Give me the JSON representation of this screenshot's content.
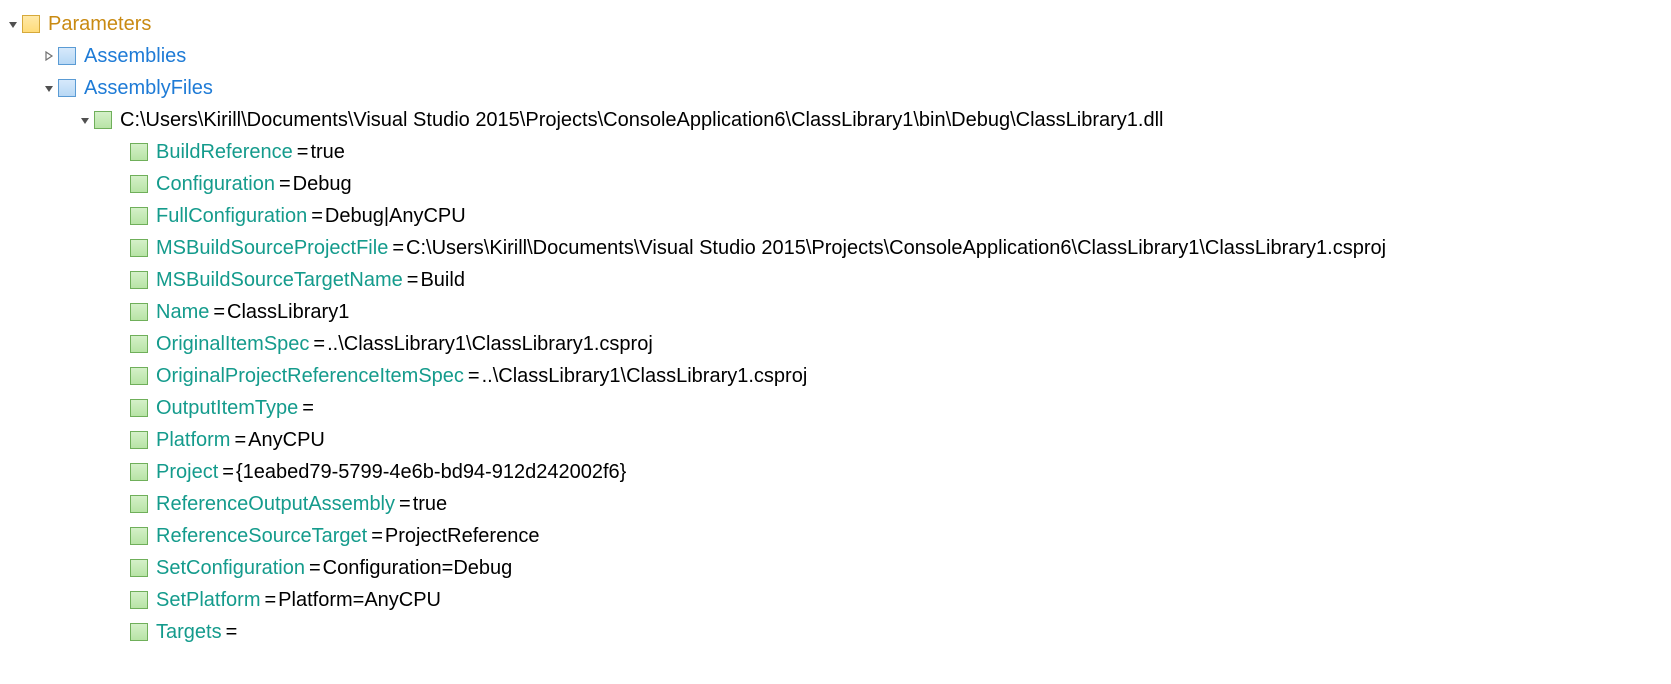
{
  "root": {
    "label": "Parameters"
  },
  "child1": {
    "label": "Assemblies"
  },
  "child2": {
    "label": "AssemblyFiles"
  },
  "file": {
    "path": "C:\\Users\\Kirill\\Documents\\Visual Studio 2015\\Projects\\ConsoleApplication6\\ClassLibrary1\\bin\\Debug\\ClassLibrary1.dll"
  },
  "props": [
    {
      "key": "BuildReference",
      "eq": " = ",
      "val": "true"
    },
    {
      "key": "Configuration",
      "eq": " = ",
      "val": "Debug"
    },
    {
      "key": "FullConfiguration",
      "eq": " = ",
      "val": "Debug|AnyCPU"
    },
    {
      "key": "MSBuildSourceProjectFile",
      "eq": " = ",
      "val": "C:\\Users\\Kirill\\Documents\\Visual Studio 2015\\Projects\\ConsoleApplication6\\ClassLibrary1\\ClassLibrary1.csproj"
    },
    {
      "key": "MSBuildSourceTargetName",
      "eq": " = ",
      "val": "Build"
    },
    {
      "key": "Name",
      "eq": " = ",
      "val": "ClassLibrary1"
    },
    {
      "key": "OriginalItemSpec",
      "eq": " = ",
      "val": "..\\ClassLibrary1\\ClassLibrary1.csproj"
    },
    {
      "key": "OriginalProjectReferenceItemSpec",
      "eq": " = ",
      "val": "..\\ClassLibrary1\\ClassLibrary1.csproj"
    },
    {
      "key": "OutputItemType",
      "eq": " =",
      "val": ""
    },
    {
      "key": "Platform",
      "eq": " = ",
      "val": "AnyCPU"
    },
    {
      "key": "Project",
      "eq": " = ",
      "val": "{1eabed79-5799-4e6b-bd94-912d242002f6}"
    },
    {
      "key": "ReferenceOutputAssembly",
      "eq": " = ",
      "val": "true"
    },
    {
      "key": "ReferenceSourceTarget",
      "eq": " = ",
      "val": "ProjectReference"
    },
    {
      "key": "SetConfiguration",
      "eq": " = ",
      "val": "Configuration=Debug"
    },
    {
      "key": "SetPlatform",
      "eq": " = ",
      "val": "Platform=AnyCPU"
    },
    {
      "key": "Targets",
      "eq": " =",
      "val": ""
    }
  ]
}
